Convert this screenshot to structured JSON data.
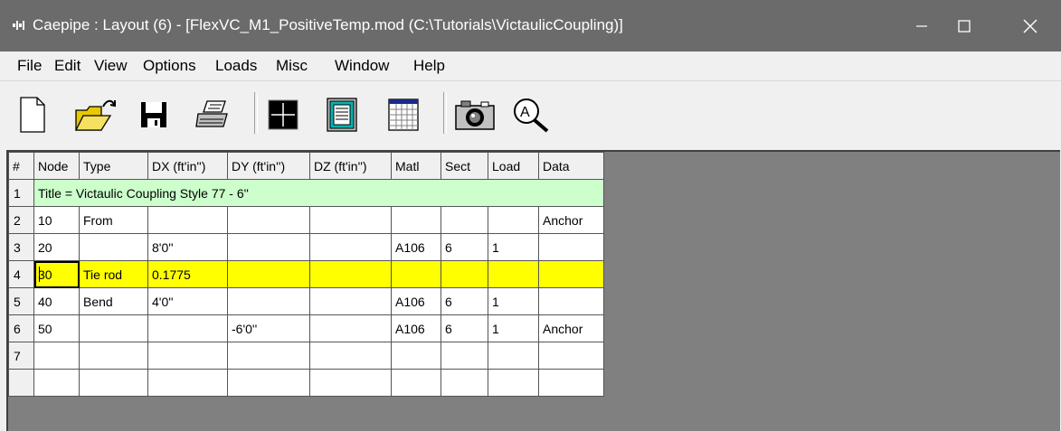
{
  "window": {
    "title": "Caepipe : Layout  (6)  -  [FlexVC_M1_PositiveTemp.mod (C:\\Tutorials\\VictaulicCoupling)]",
    "controls": [
      "minimize",
      "maximize",
      "close"
    ]
  },
  "menu": {
    "items": [
      {
        "label": "File"
      },
      {
        "label": "Edit"
      },
      {
        "label": "View"
      },
      {
        "label": "Options"
      },
      {
        "label": "Loads"
      },
      {
        "label": "Misc"
      },
      {
        "label": "Window"
      },
      {
        "label": "Help"
      }
    ]
  },
  "toolbar": {
    "buttons": [
      {
        "icon": "new-file-icon"
      },
      {
        "icon": "open-folder-icon"
      },
      {
        "icon": "save-icon"
      },
      {
        "icon": "print-icon"
      },
      {
        "icon": "graphics-window-icon"
      },
      {
        "icon": "layout-list-icon"
      },
      {
        "icon": "spreadsheet-icon"
      },
      {
        "icon": "camera-icon"
      },
      {
        "icon": "zoom-magnifier-icon"
      }
    ]
  },
  "grid": {
    "columns": [
      "#",
      "Node",
      "Type",
      "DX (ft'in'')",
      "DY (ft'in'')",
      "DZ (ft'in'')",
      "Matl",
      "Sect",
      "Load",
      "Data"
    ],
    "title_row": {
      "num": "1",
      "text": "Title = Victaulic Coupling Style 77 - 6''"
    },
    "rows": [
      {
        "num": "2",
        "node": "10",
        "type": "From",
        "dx": "",
        "dy": "",
        "dz": "",
        "matl": "",
        "sect": "",
        "load": "",
        "data": "Anchor"
      },
      {
        "num": "3",
        "node": "20",
        "type": "",
        "dx": "8'0''",
        "dy": "",
        "dz": "",
        "matl": "A106",
        "sect": "6",
        "load": "1",
        "data": ""
      },
      {
        "num": "4",
        "node": "30",
        "type": "Tie rod",
        "dx": "0.1775",
        "dy": "",
        "dz": "",
        "matl": "",
        "sect": "",
        "load": "",
        "data": ""
      },
      {
        "num": "5",
        "node": "40",
        "type": "Bend",
        "dx": "4'0''",
        "dy": "",
        "dz": "",
        "matl": "A106",
        "sect": "6",
        "load": "1",
        "data": ""
      },
      {
        "num": "6",
        "node": "50",
        "type": "",
        "dx": "",
        "dy": "-6'0''",
        "dz": "",
        "matl": "A106",
        "sect": "6",
        "load": "1",
        "data": "Anchor"
      },
      {
        "num": "7",
        "node": "",
        "type": "",
        "dx": "",
        "dy": "",
        "dz": "",
        "matl": "",
        "sect": "",
        "load": "",
        "data": ""
      },
      {
        "num": "",
        "node": "",
        "type": "",
        "dx": "",
        "dy": "",
        "dz": "",
        "matl": "",
        "sect": "",
        "load": "",
        "data": ""
      }
    ],
    "selected_row_num": "4",
    "colors": {
      "title_row": "#ccffcc",
      "selected_row": "#ffff00"
    }
  }
}
